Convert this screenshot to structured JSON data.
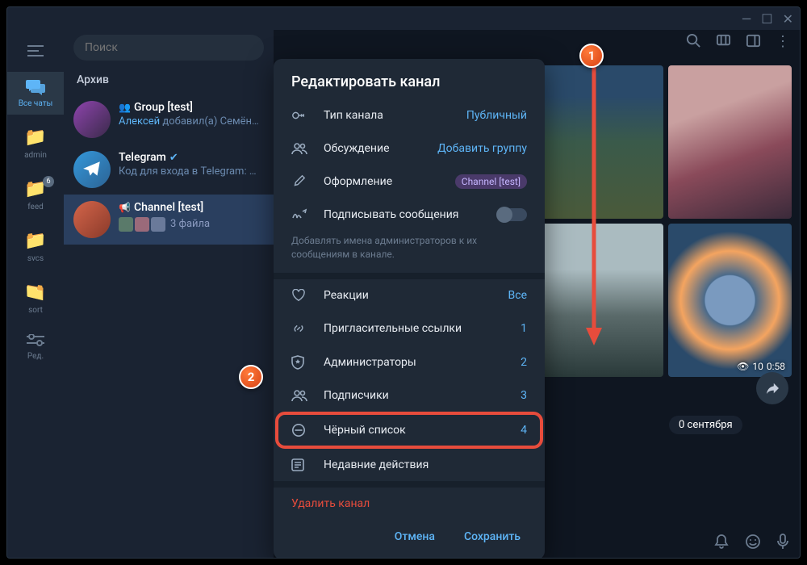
{
  "window": {
    "minimize": "—",
    "maximize": "☐",
    "close": "✕"
  },
  "search": {
    "placeholder": "Поиск"
  },
  "sidebar": {
    "all": "Все чаты",
    "items": [
      {
        "label": "admin"
      },
      {
        "label": "feed",
        "badge": "6"
      },
      {
        "label": "svcs"
      },
      {
        "label": "sort"
      },
      {
        "label": "Ред."
      }
    ]
  },
  "archive_label": "Архив",
  "chats": [
    {
      "title": "Group [test]",
      "sub": "Алексей добавил(а) Семён…",
      "sub_hl": "Алексей"
    },
    {
      "title": "Telegram",
      "sub": "Код для входа в Telegram: …",
      "verified": true
    },
    {
      "title": "Channel [test]",
      "files": "3 файла"
    }
  ],
  "modal": {
    "title": "Редактировать канал",
    "channel_type": {
      "label": "Тип канала",
      "value": "Публичный"
    },
    "discussion": {
      "label": "Обсуждение",
      "value": "Добавить группу"
    },
    "theme": {
      "label": "Оформление",
      "value": "Channel [test]"
    },
    "sign": {
      "label": "Подписывать сообщения"
    },
    "sign_hint": "Добавлять имена администраторов к их сообщениям в канале.",
    "reactions": {
      "label": "Реакции",
      "value": "Все"
    },
    "invite": {
      "label": "Пригласительные ссылки",
      "value": "1"
    },
    "admins": {
      "label": "Администраторы",
      "value": "2"
    },
    "subs": {
      "label": "Подписчики",
      "value": "3"
    },
    "blacklist": {
      "label": "Чёрный список",
      "value": "4"
    },
    "recent": {
      "label": "Недавние действия"
    },
    "delete": {
      "label": "Удалить канал"
    },
    "cancel": "Отмена",
    "save": "Сохранить"
  },
  "gallery": {
    "views": "10",
    "time": "0:58",
    "date": "0 сентября"
  },
  "callouts": {
    "c1": "1",
    "c2": "2"
  }
}
